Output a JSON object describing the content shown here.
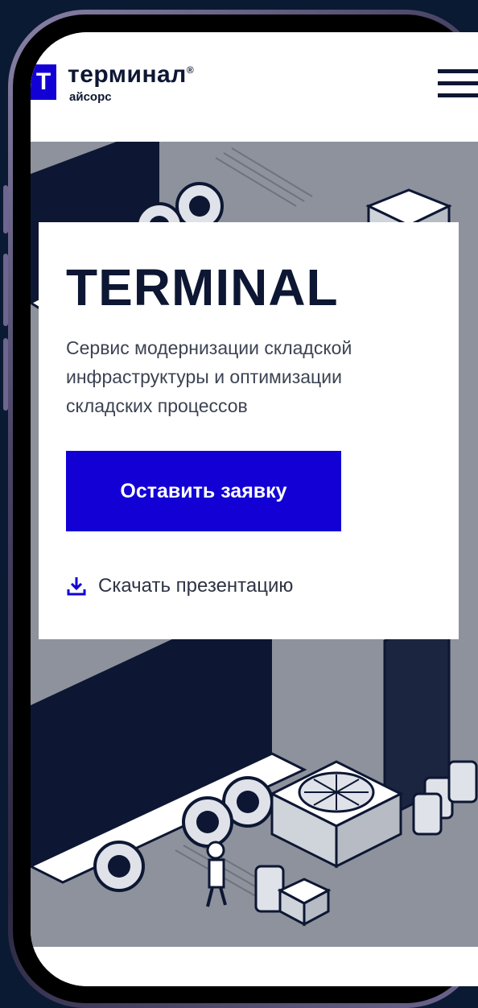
{
  "header": {
    "logo_letter": "T",
    "brand_name": "терминал",
    "brand_mark": "®",
    "brand_sub": "айсорс",
    "menu_icon": "hamburger-menu-icon"
  },
  "hero": {
    "title": "TERMINAL",
    "description": "Сервис модернизации складской инфраструктуры и оптимизации складских процессов",
    "cta_label": "Оставить заявку",
    "download_label": "Скачать презентацию",
    "download_icon": "download-icon"
  },
  "colors": {
    "accent": "#1200d4",
    "text_dark": "#0d1733",
    "text_muted": "#3c4353",
    "page_bg": "#0a1a33",
    "illustration_gray": "#8d929c"
  }
}
